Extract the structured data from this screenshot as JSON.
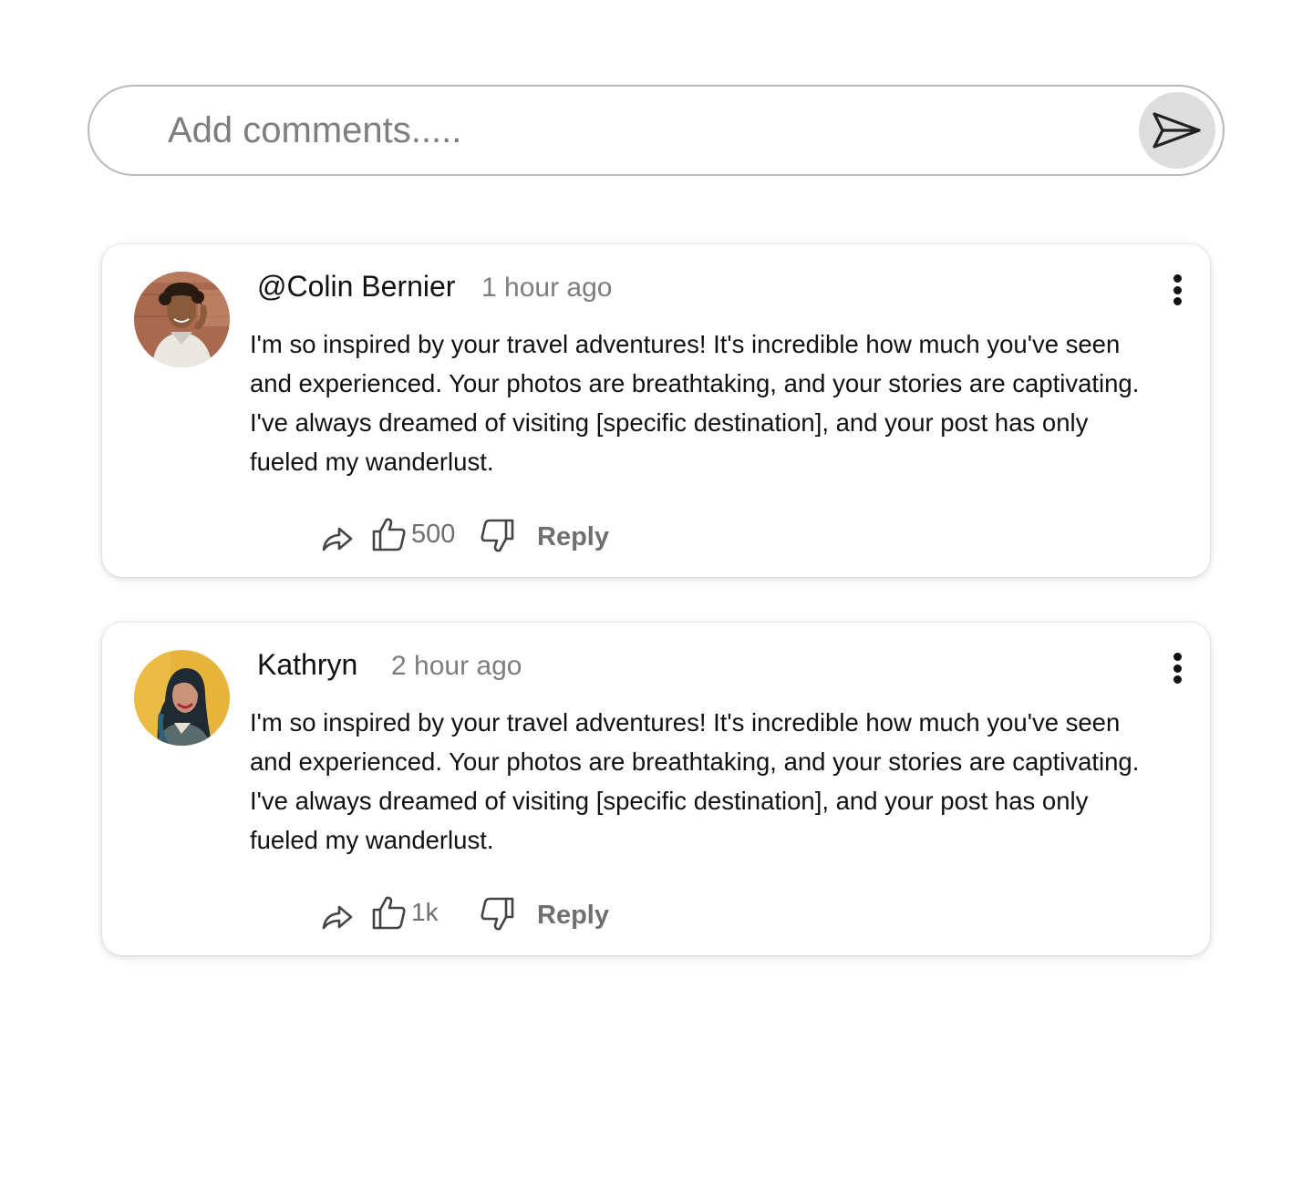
{
  "composer": {
    "placeholder": "Add comments....."
  },
  "comments": [
    {
      "author": "@Colin Bernier",
      "time": "1 hour ago",
      "text": "I'm so inspired by your travel adventures! It's incredible how much you've seen and experienced. Your photos are breathtaking, and your stories are captivating. I've always dreamed of visiting [specific destination], and your post has only fueled my wanderlust.",
      "likes": "500",
      "reply_label": "Reply",
      "avatar_bg": "#a9694f"
    },
    {
      "author": "Kathryn",
      "time": "2 hour ago",
      "text": "I'm so inspired by your travel adventures! It's incredible how much you've seen and experienced. Your photos are breathtaking, and your stories are captivating. I've always dreamed of visiting [specific destination], and your post has only fueled my wanderlust.",
      "likes": "1k",
      "reply_label": "Reply",
      "avatar_bg": "#e7b43b"
    }
  ],
  "icons": {
    "send": "send-icon",
    "share": "share-icon",
    "like": "thumbs-up-icon",
    "dislike": "thumbs-down-icon",
    "more": "more-vertical-icon"
  }
}
